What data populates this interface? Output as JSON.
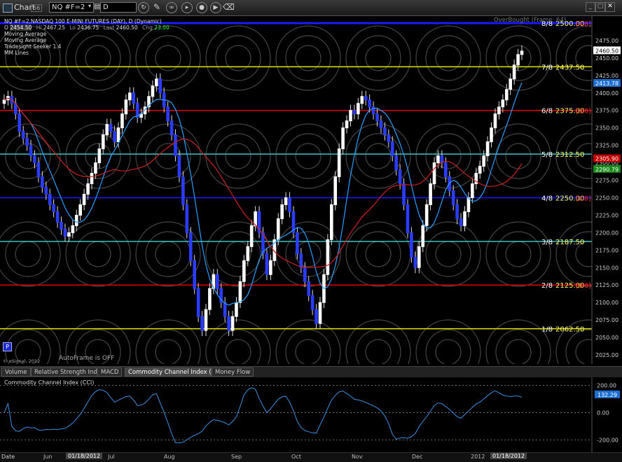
{
  "toolbar": {
    "title": "Chart",
    "badge": "56",
    "symbol": "NQ #F=2",
    "interval": "D",
    "icons": [
      "reload-icon",
      "pencil-icon",
      "link-icon",
      "play-icon",
      "play-circle-icon",
      "eraser-icon"
    ]
  },
  "header": {
    "line1": "NQ #F=2,NASDAQ 100 E-MINI FUTURES (DAY), D (Dynamic)",
    "open_label": "O",
    "open": "2454.50",
    "high_label": "Hi",
    "high": "2467.25",
    "low_label": "Lo",
    "low": "2436.75",
    "last_label": "Last",
    "last": "2460.50",
    "chg_label": "Chg",
    "chg": "23.00",
    "studies": [
      "Moving Average",
      "Moving Average",
      "Tradesight Seeker 1.4",
      "MM Lines"
    ]
  },
  "overbought_label": "OverBought (Frame: 64)",
  "autoframe": "AutoFrame is OFF",
  "copyright": "© eSignal, 2012",
  "p_badge": "P",
  "mm_lines": [
    {
      "frac": "8/8",
      "price": "2500.00",
      "tag": "[4/8]",
      "value": 2500,
      "color": "#1a1aff"
    },
    {
      "frac": "7/8",
      "price": "2437.50",
      "tag": "",
      "value": 2437.5,
      "color": "#e6e600"
    },
    {
      "frac": "6/8",
      "price": "2375.00",
      "tag": "[3/8]",
      "value": 2375,
      "color": "#e00000"
    },
    {
      "frac": "5/8",
      "price": "2312.50",
      "tag": "",
      "value": 2312.5,
      "color": "#40c0c0"
    },
    {
      "frac": "4/8",
      "price": "2250.00",
      "tag": "[2/8]",
      "value": 2250,
      "color": "#1a1aff"
    },
    {
      "frac": "3/8",
      "price": "2187.50",
      "tag": "",
      "value": 2187.5,
      "color": "#40c0c0"
    },
    {
      "frac": "2/8",
      "price": "2125.00",
      "tag": "[1/8]",
      "value": 2125,
      "color": "#e00000"
    },
    {
      "frac": "1/8",
      "price": "2062.50",
      "tag": "",
      "value": 2062.5,
      "color": "#e6e600"
    }
  ],
  "price_axis": {
    "min": 2012,
    "max": 2510,
    "ticks": [
      "2475.00",
      "2450.00",
      "2425.00",
      "2400.00",
      "2375.00",
      "2350.00",
      "2325.00",
      "2300.00",
      "2275.00",
      "2250.00",
      "2225.00",
      "2200.00",
      "2175.00",
      "2150.00",
      "2125.00",
      "2100.00",
      "2075.00",
      "2050.00",
      "2025.00"
    ],
    "tick_values": [
      2475,
      2450,
      2425,
      2400,
      2375,
      2350,
      2325,
      2300,
      2275,
      2250,
      2225,
      2200,
      2175,
      2150,
      2125,
      2100,
      2075,
      2050,
      2025
    ],
    "markers": [
      {
        "label": "2460.50",
        "value": 2460.5,
        "bg": "#ffffff",
        "fg": "#000000"
      },
      {
        "label": "2413.78",
        "value": 2413.78,
        "bg": "#1f6fd0",
        "fg": "#ffffff"
      },
      {
        "label": "2305.90",
        "value": 2305.9,
        "bg": "#c00000",
        "fg": "#ffffff"
      },
      {
        "label": "2290.79",
        "value": 2290.79,
        "bg": "#1a8a1a",
        "fg": "#ffffff"
      }
    ]
  },
  "cci": {
    "title": "Commodity Channel Index (CCI)",
    "ticks": [
      "200.00",
      "0.00",
      "-200.00"
    ],
    "tick_values": [
      200,
      0,
      -200
    ],
    "min": -290,
    "max": 260,
    "marker": {
      "label": "132.29",
      "value": 132.29
    }
  },
  "tabs": [
    "Volume",
    "Relative Strength Index",
    "MACD",
    "Commodity Channel Index (CCI)",
    "Money Flow"
  ],
  "active_tab": 3,
  "x_axis": {
    "labels": [
      "Jun",
      "Jul",
      "Aug",
      "Sep",
      "Oct",
      "Nov",
      "Dec",
      "2012"
    ],
    "cursor_dates": [
      "01/18/2012",
      "01/18/2012"
    ],
    "date_label": "Date"
  },
  "chart_data": {
    "type": "candlestick",
    "title": "NQ #F=2,NASDAQ 100 E-MINI FUTURES (DAY), D (Dynamic)",
    "closes": [
      2390,
      2395,
      2385,
      2370,
      2345,
      2335,
      2325,
      2310,
      2300,
      2280,
      2265,
      2255,
      2240,
      2230,
      2215,
      2205,
      2195,
      2200,
      2210,
      2225,
      2240,
      2255,
      2270,
      2285,
      2300,
      2320,
      2340,
      2355,
      2345,
      2330,
      2350,
      2370,
      2390,
      2400,
      2385,
      2365,
      2370,
      2380,
      2395,
      2410,
      2420,
      2400,
      2380,
      2360,
      2340,
      2310,
      2280,
      2240,
      2200,
      2160,
      2120,
      2080,
      2060,
      2090,
      2120,
      2140,
      2120,
      2100,
      2080,
      2060,
      2080,
      2100,
      2130,
      2160,
      2180,
      2210,
      2230,
      2200,
      2170,
      2140,
      2160,
      2190,
      2220,
      2240,
      2250,
      2230,
      2200,
      2170,
      2150,
      2130,
      2110,
      2090,
      2070,
      2100,
      2140,
      2190,
      2240,
      2280,
      2320,
      2350,
      2360,
      2375,
      2370,
      2385,
      2395,
      2390,
      2380,
      2370,
      2360,
      2350,
      2340,
      2330,
      2310,
      2290,
      2270,
      2240,
      2200,
      2165,
      2150,
      2180,
      2210,
      2240,
      2270,
      2300,
      2310,
      2300,
      2280,
      2260,
      2240,
      2220,
      2210,
      2230,
      2250,
      2270,
      2285,
      2295,
      2310,
      2330,
      2350,
      2370,
      2380,
      2390,
      2405,
      2420,
      2440,
      2455,
      2460
    ]
  }
}
